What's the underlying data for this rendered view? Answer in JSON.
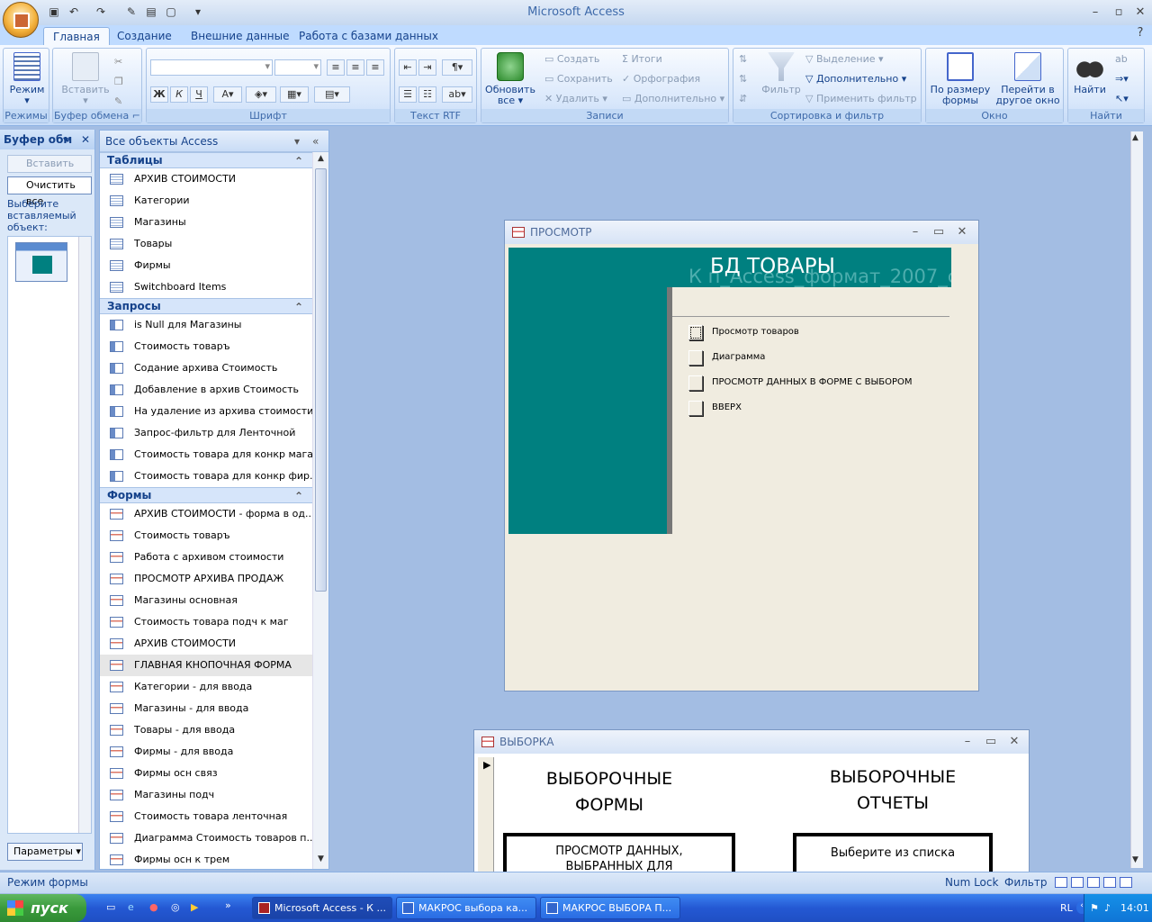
{
  "app": {
    "title": "Microsoft Access"
  },
  "tabs": [
    "Главная",
    "Создание",
    "Внешние данные",
    "Работа с базами данных"
  ],
  "ribbon": {
    "groups": {
      "views": "Режимы",
      "clipboard": "Буфер обмена",
      "font": "Шрифт",
      "rtf": "Текст RTF",
      "records": "Записи",
      "sort": "Сортировка и фильтр",
      "window": "Окно",
      "find": "Найти"
    },
    "view_btn": "Режим",
    "paste_btn": "Вставить",
    "refresh_btn": [
      "Обновить",
      "все"
    ],
    "create": "Создать",
    "save": "Сохранить",
    "delete": "Удалить",
    "totals": "Итоги",
    "spelling": "Орфография",
    "more": "Дополнительно",
    "filter_btn": "Фильтр",
    "selection": "Выделение",
    "advanced": "Дополнительно",
    "apply_filter": "Применить фильтр",
    "fit_form": [
      "По размеру",
      "формы"
    ],
    "switch_window": [
      "Перейти в",
      "другое окно"
    ],
    "find_btn": "Найти",
    "bold": "Ж",
    "italic": "К",
    "underline": "Ч"
  },
  "clipboard_pane": {
    "title": "Буфер обм",
    "paste_all": "Вставить все",
    "clear_all": "Очистить все",
    "hint": [
      "Выберите",
      "вставляемый",
      "объект:"
    ],
    "options_btn": "Параметры"
  },
  "nav": {
    "header": "Все объекты Access",
    "sections": [
      {
        "title": "Таблицы",
        "type": "table",
        "items": [
          "АРХИВ СТОИМОСТИ",
          "Категории",
          "Магазины",
          "Товары",
          "Фирмы",
          "Switchboard Items"
        ]
      },
      {
        "title": "Запросы",
        "type": "query",
        "items": [
          "is Null для Магазины",
          "Стоимость товаръ",
          "Содание архива Стоимость",
          "Добавление в архив Стоимость",
          "На удаление из архива стоимости",
          "Запрос-фильтр для Ленточной",
          "Стоимость товара для конкр мага...",
          "Стоимость товара для конкр фир..."
        ]
      },
      {
        "title": "Формы",
        "type": "form",
        "items": [
          "АРХИВ СТОИМОСТИ - форма в од...",
          "Стоимость товаръ",
          "Работа с архивом стоимости",
          "ПРОСМОТР АРХИВА ПРОДАЖ",
          "Магазины основная",
          "Стоимость товара подч к маг",
          "АРХИВ СТОИМОСТИ",
          "ГЛАВНАЯ КНОПОЧНАЯ ФОРМА",
          "Категории - для ввода",
          "Магазины - для ввода",
          "Товары - для ввода",
          "Фирмы - для ввода",
          "Фирмы осн связ",
          "Магазины подч",
          "Стоимость товара ленточная",
          "Диаграмма Стоимость товаров п...",
          "Фирмы осн к трем"
        ]
      }
    ],
    "selected": "ГЛАВНАЯ КНОПОЧНАЯ ФОРМА"
  },
  "window1": {
    "title": "ПРОСМОТР",
    "header_title": "БД ТОВАРЫ",
    "header_sub": "К п_Access_формат_2007_с",
    "buttons": [
      "Просмотр товаров",
      "Диаграмма",
      "ПРОСМОТР ДАННЫХ  В ФОРМЕ С ВЫБОРОМ",
      "ВВЕРХ"
    ]
  },
  "window2": {
    "title": "ВЫБОРКА",
    "left_heading": [
      "ВЫБОРОЧНЫЕ",
      "ФОРМЫ"
    ],
    "right_heading": [
      "ВЫБОРОЧНЫЕ",
      "ОТЧЕТЫ"
    ],
    "left_box": [
      "ПРОСМОТР ДАННЫХ,",
      "ВЫБРАННЫХ ДЛЯ"
    ],
    "right_box": [
      "Выберите из списка",
      ""
    ]
  },
  "status": {
    "left": "Режим формы",
    "numlock": "Num Lock",
    "filter": "Фильтр"
  },
  "taskbar": {
    "start": "пуск",
    "tasks": [
      "Microsoft Access - К ...",
      "МАКРОС выбора ка...",
      "МАКРОС ВЫБОРА П..."
    ],
    "lang": "RL",
    "time": "14:01"
  },
  "colors": {
    "teal": "#008080",
    "form_bg": "#f0ece0",
    "ribbon_text": "#15428b"
  }
}
